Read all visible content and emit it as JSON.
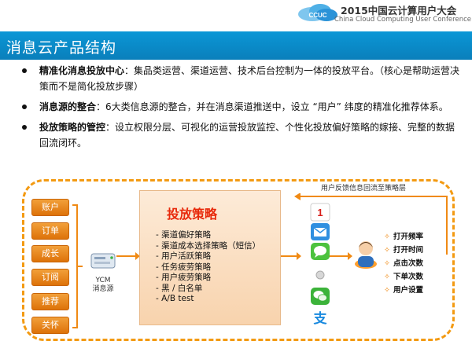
{
  "conference": {
    "title": "2015中国云计算用户大会",
    "subtitle": "China Cloud Computing User Conference",
    "logo_text": "CCUC"
  },
  "slide_title": "消息云产品结构",
  "bullets": [
    {
      "bold": "精准化消息投放中心",
      "text": "：集品类运营、渠道运营、技术后台控制为一体的投放平台。（核心是帮助运营决策而不是简化投放步骤）"
    },
    {
      "bold": "消息源的整合",
      "text": "：6大类信息源的整合，并在消息渠道推送中，设立 “用户” 纬度的精准化推荐体系。"
    },
    {
      "bold": "投放策略的管控",
      "text": "：设立权限分层、可视化的运营投放监控、个性化投放偏好策略的嫁接、完整的数据回流闭环。"
    }
  ],
  "sources": [
    "账户",
    "订单",
    "成长",
    "订阅",
    "推荐",
    "关怀"
  ],
  "ycm": {
    "label_line1": "YCM",
    "label_line2": "消息源"
  },
  "strategy": {
    "title": "投放策略",
    "items": [
      "- 渠道偏好策略",
      "- 渠道成本选择策略（短信）",
      "- 用户活跃策略",
      "- 任务疲劳策略",
      "- 用户疲劳策略",
      "- 黑 / 白名单",
      "- A/B test"
    ]
  },
  "feedback_label": "用户反馈信息回流至策略层",
  "channels": [
    "sms-icon",
    "email-icon",
    "message-icon",
    "dot-icon",
    "wechat-icon",
    "alipay-icon"
  ],
  "metrics": [
    "打开频率",
    "打开时间",
    "点击次数",
    "下单次数",
    "用户设置"
  ],
  "colors": {
    "title_bar": "#0b97d6",
    "orange": "#f39a12",
    "strategy_title": "#e8290b"
  }
}
